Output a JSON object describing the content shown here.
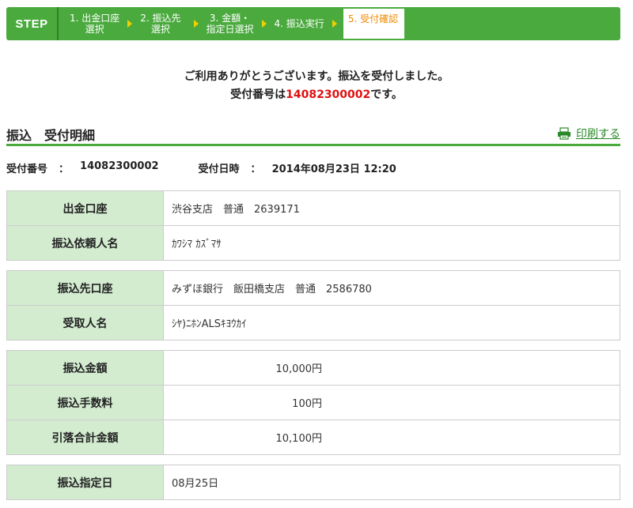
{
  "stepbar": {
    "label": "STEP",
    "steps": [
      {
        "line1": "1. 出金口座",
        "line2": "選択"
      },
      {
        "line1": "2. 振込先",
        "line2": "選択"
      },
      {
        "line1": "3. 金額・",
        "line2": "指定日選択"
      },
      {
        "line1": "4. 振込実行",
        "line2": ""
      },
      {
        "line1": "5. 受付確認",
        "line2": ""
      }
    ],
    "current_step": 5
  },
  "message": {
    "line1": "ご利用ありがとうございます。振込を受付しました。",
    "line2_prefix": "受付番号は",
    "line2_number": "14082300002",
    "line2_suffix": "です。"
  },
  "section": {
    "title": "振込　受付明細",
    "print_label": "印刷する"
  },
  "info": {
    "reception_number_label": "受付番号",
    "reception_number_value": "14082300002",
    "reception_datetime_label": "受付日時",
    "reception_datetime_value": "2014年08月23日 12:20",
    "separator": "："
  },
  "account_table": [
    {
      "label": "出金口座",
      "value": "渋谷支店　普通　2639171"
    },
    {
      "label": "振込依頼人名",
      "value": "ｶﾜｼﾏ ｶｽﾞﾏｻ"
    }
  ],
  "payee_table": [
    {
      "label": "振込先口座",
      "value": "みずほ銀行　飯田橋支店　普通　2586780"
    },
    {
      "label": "受取人名",
      "value": "ｼﾔ)ﾆﾎﾝALSｷﾖｳｶｲ"
    }
  ],
  "amount_table": [
    {
      "label": "振込金額",
      "value": "10,000円"
    },
    {
      "label": "振込手数料",
      "value": "100円"
    },
    {
      "label": "引落合計金額",
      "value": "10,100円"
    }
  ],
  "date_table": [
    {
      "label": "振込指定日",
      "value": "08月25日"
    }
  ],
  "colors": {
    "brand_green": "#4aaa3e",
    "header_cell": "#d3ecd0",
    "accent_red": "#e01010",
    "current_step_text": "#f08a00"
  }
}
